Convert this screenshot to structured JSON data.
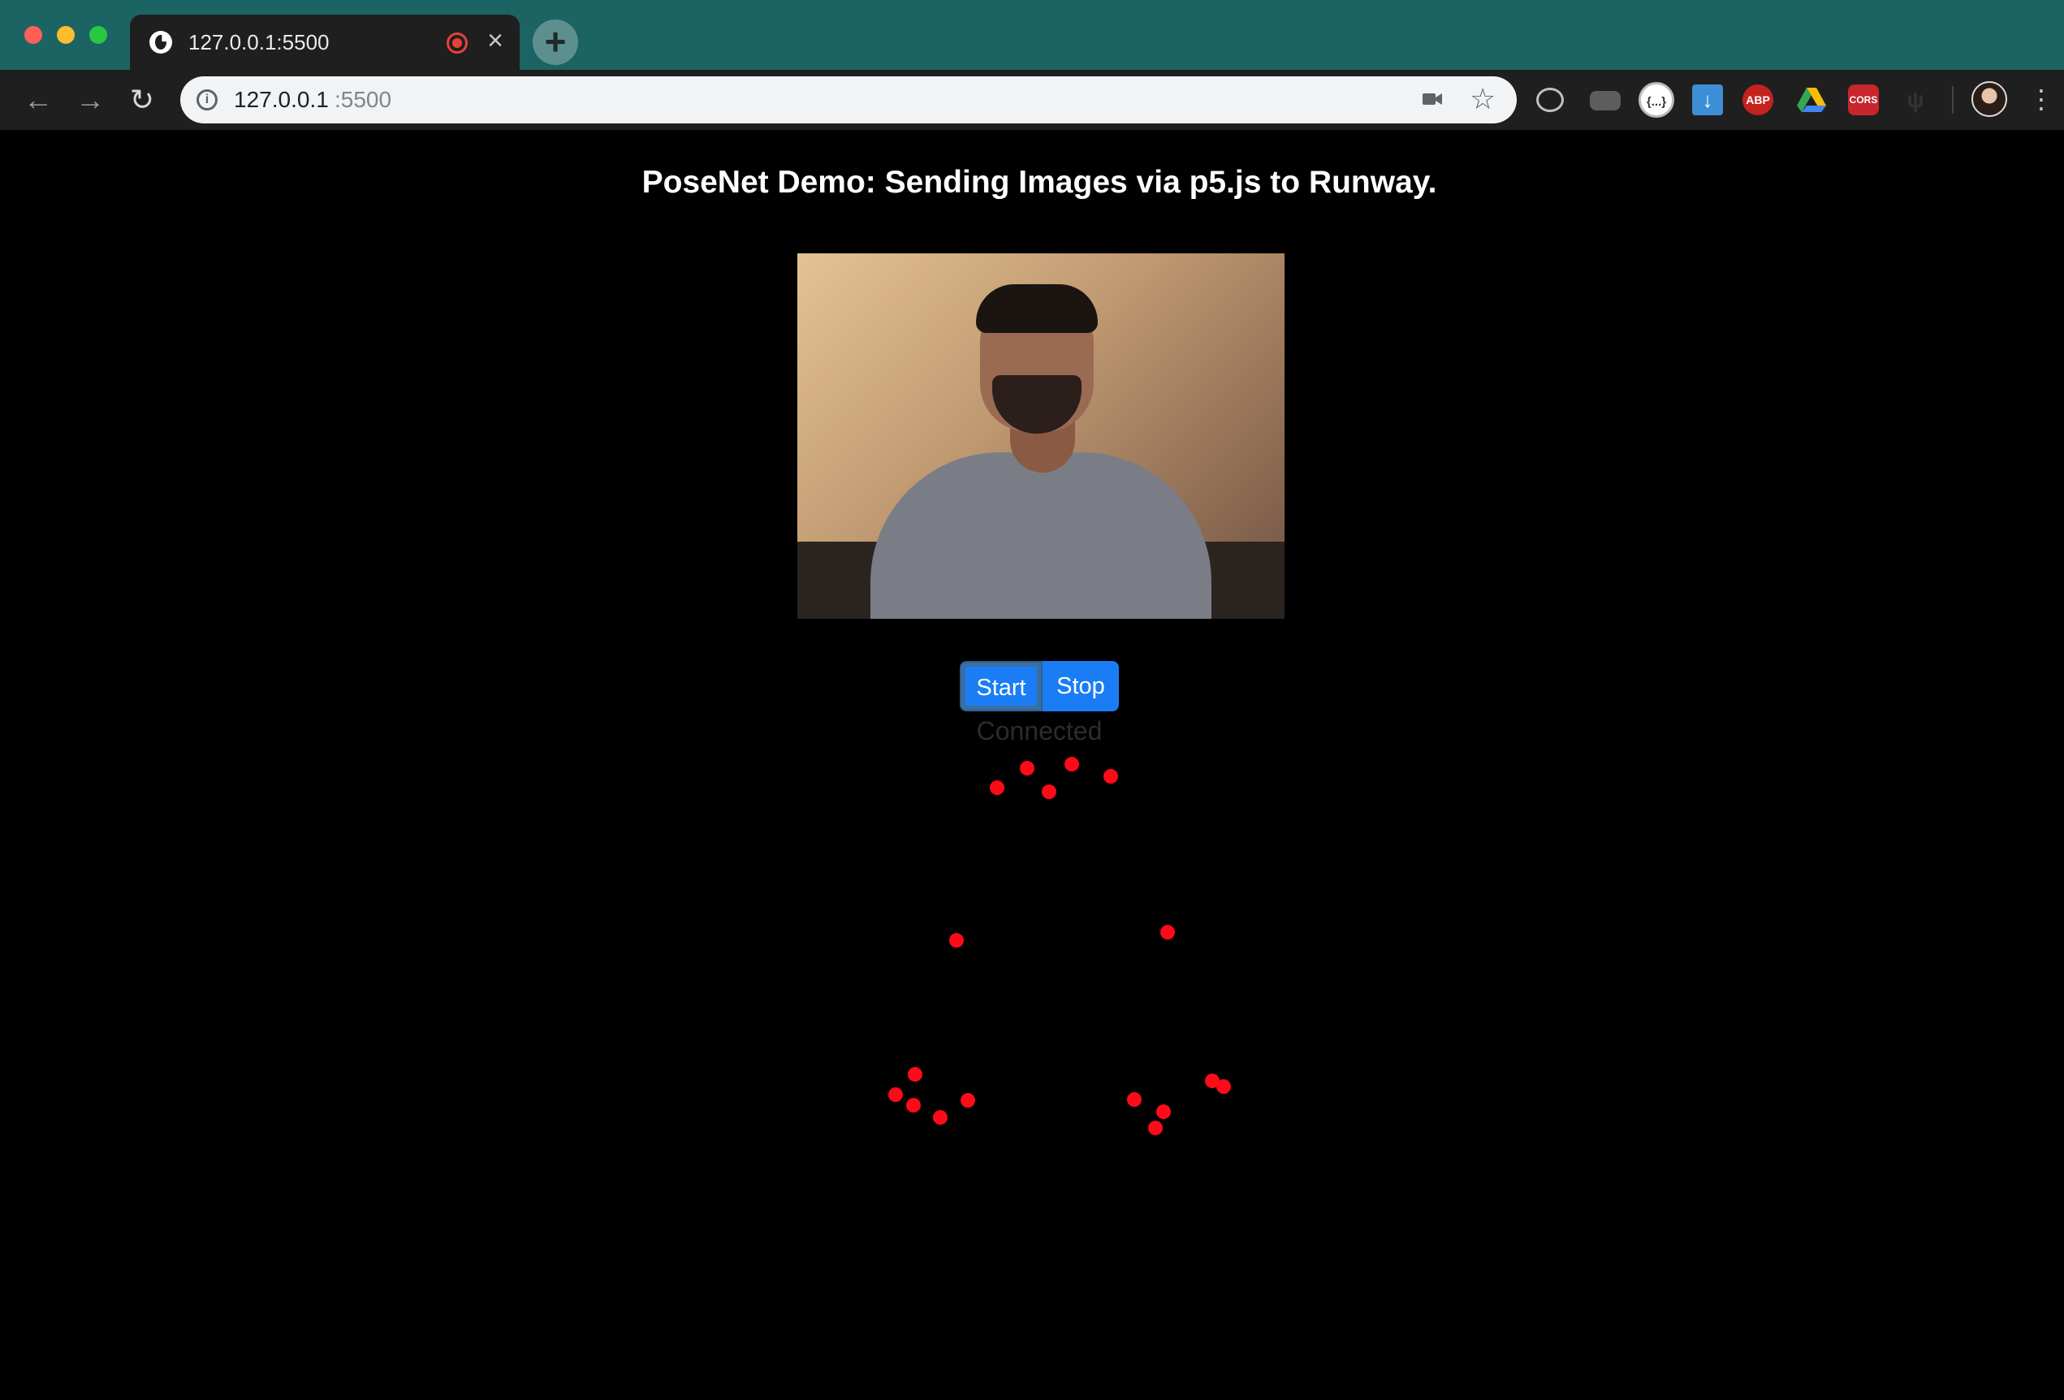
{
  "window": {
    "tab_title": "127.0.0.1:5500",
    "new_tab_symbol": "+",
    "close_tab_symbol": "×"
  },
  "address_bar": {
    "url_host": "127.0.0.1",
    "url_port": ":5500"
  },
  "extensions": {
    "json_label": "{...}",
    "abp_label": "ABP",
    "cors_label": "CORS"
  },
  "page": {
    "title": "PoseNet Demo: Sending Images via p5.js to Runway.",
    "start_label": "Start",
    "stop_label": "Stop",
    "status": "Connected"
  },
  "colors": {
    "tabbar": "#1c6464",
    "button": "#1a7df5",
    "keypoint": "#ff0a18"
  },
  "icons": [
    "globe-icon",
    "record-icon",
    "close-icon",
    "plus-icon",
    "back-arrow-icon",
    "forward-arrow-icon",
    "reload-icon",
    "info-icon",
    "camera-icon",
    "star-icon",
    "chat-icon",
    "folder-icon",
    "download-icon",
    "drive-icon",
    "antenna-icon",
    "menu-icon"
  ]
}
